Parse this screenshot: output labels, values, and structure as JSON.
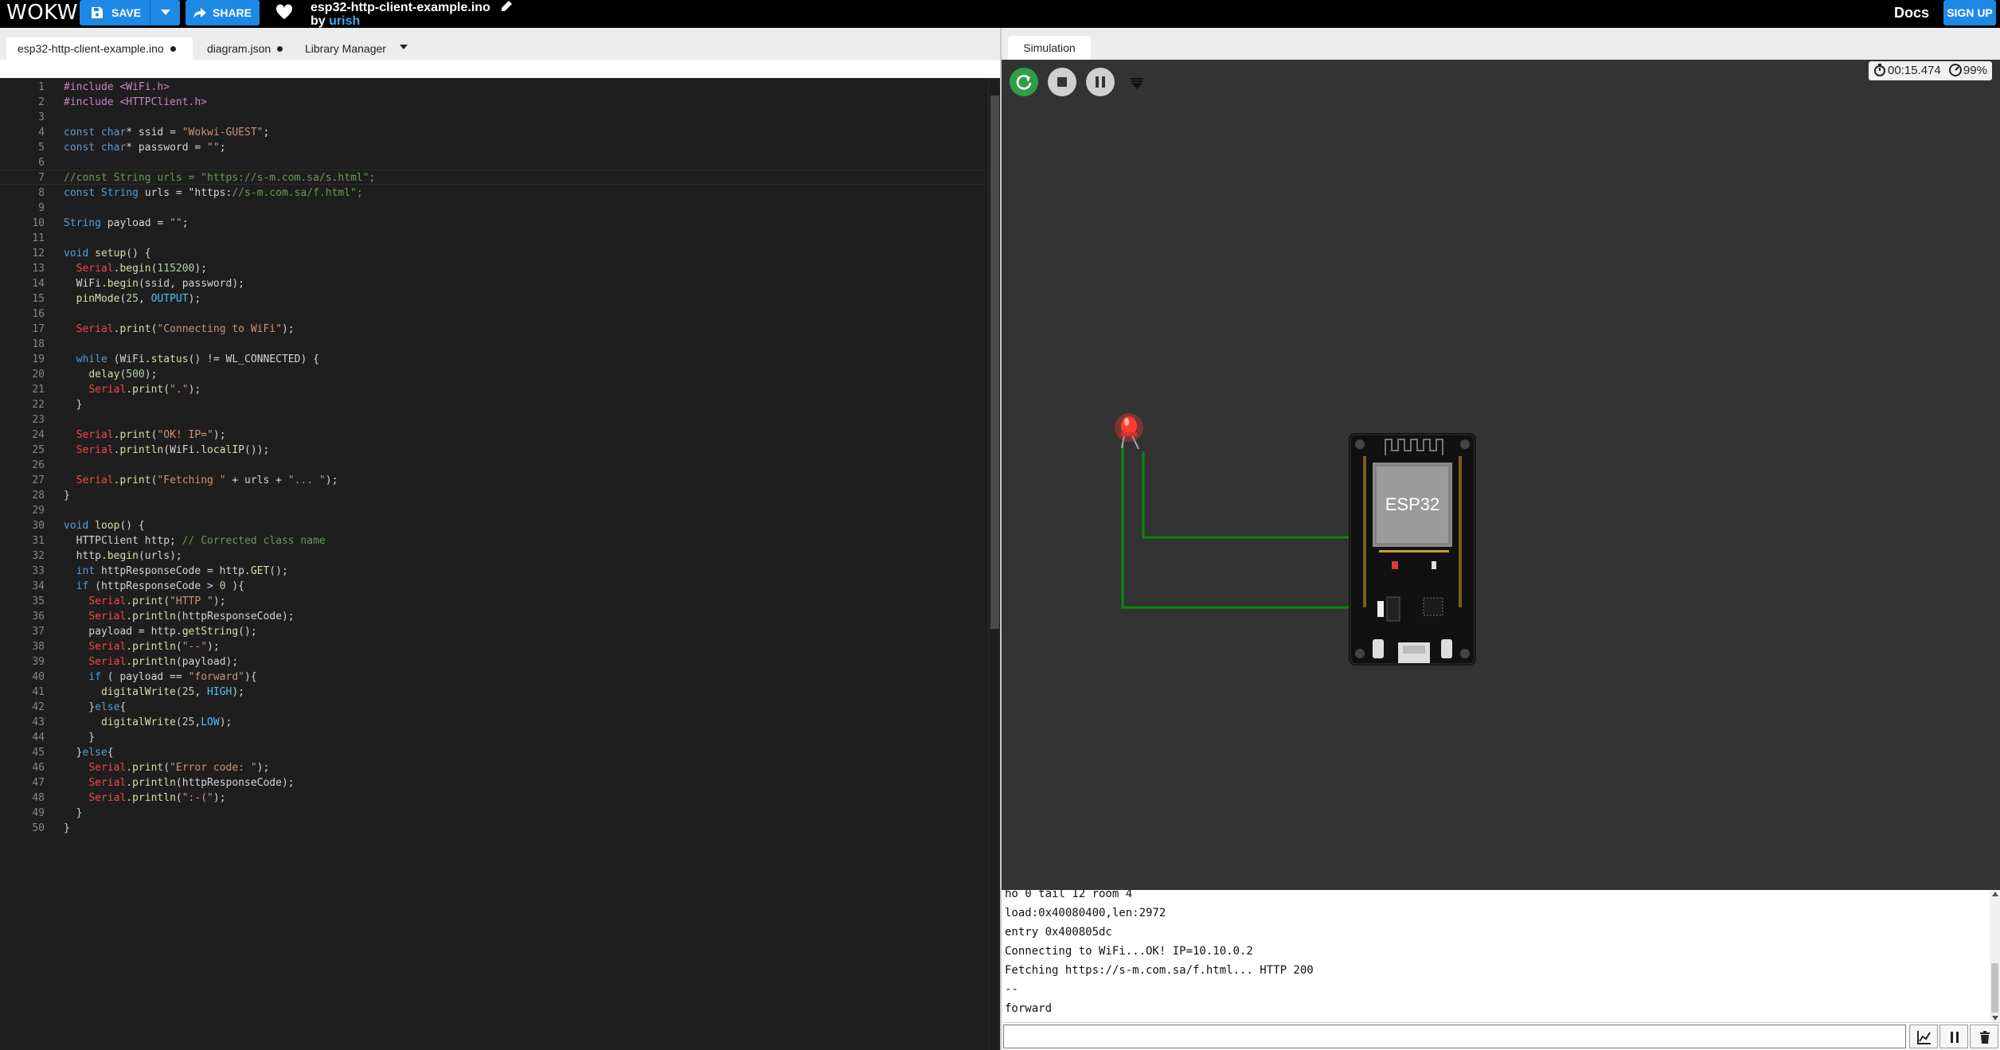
{
  "topbar": {
    "logo": "WOKWI",
    "save_label": "SAVE",
    "share_label": "SHARE",
    "project_title": "esp32-http-client-example.ino",
    "by_label": "by",
    "author": "urish",
    "docs_label": "Docs",
    "signup_label": "SIGN UP"
  },
  "editor": {
    "tabs": [
      {
        "label": "esp32-http-client-example.ino",
        "modified": true
      },
      {
        "label": "diagram.json",
        "modified": true
      },
      {
        "label": "Library Manager"
      }
    ]
  },
  "simulation": {
    "tab_label": "Simulation",
    "timer": "00:15.474",
    "speed": "99%",
    "board_label": "ESP32",
    "led_color": "#ff3b30",
    "wire_color": "#0a8a0a"
  },
  "serial": {
    "lines": [
      "ho 0 tail 12 room 4",
      "load:0x40080400,len:2972",
      "entry 0x400805dc",
      "Connecting to WiFi...OK! IP=10.10.0.2",
      "Fetching https://s-m.com.sa/f.html... HTTP 200",
      "--",
      "forward"
    ],
    "input_value": ""
  },
  "code": [
    "#include <WiFi.h>",
    "#include <HTTPClient.h>",
    "",
    "const char* ssid = \"Wokwi-GUEST\";",
    "const char* password = \"\";",
    "",
    "//const String urls = \"https://s-m.com.sa/s.html\";",
    "const String urls = \"https://s-m.com.sa/f.html\";",
    "",
    "String payload = \"\";",
    "",
    "void setup() {",
    "  Serial.begin(115200);",
    "  WiFi.begin(ssid, password);",
    "  pinMode(25, OUTPUT);",
    "",
    "  Serial.print(\"Connecting to WiFi\");",
    "",
    "  while (WiFi.status() != WL_CONNECTED) {",
    "    delay(500);",
    "    Serial.print(\".\");",
    "  }",
    "",
    "  Serial.print(\"OK! IP=\");",
    "  Serial.println(WiFi.localIP());",
    "",
    "  Serial.print(\"Fetching \" + urls + \"... \");",
    "}",
    "",
    "void loop() {",
    "  HTTPClient http; // Corrected class name",
    "  http.begin(urls);",
    "  int httpResponseCode = http.GET();",
    "  if (httpResponseCode > 0 ){",
    "    Serial.print(\"HTTP \");",
    "    Serial.println(httpResponseCode);",
    "    payload = http.getString();",
    "    Serial.println(\"--\");",
    "    Serial.println(payload);",
    "    if ( payload == \"forward\"){",
    "      digitalWrite(25, HIGH);",
    "    }else{",
    "      digitalWrite(25,LOW);",
    "    }",
    "  }else{",
    "    Serial.print(\"Error code: \");",
    "    Serial.println(httpResponseCode);",
    "    Serial.println(\":-(\");",
    "  }",
    "}"
  ]
}
